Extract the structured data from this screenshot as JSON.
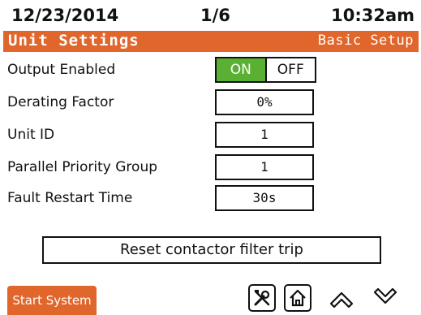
{
  "status_bar": {
    "date": "12/23/2014",
    "page": "1/6",
    "time": "10:32am"
  },
  "title_bar": {
    "title": "Unit Settings",
    "section": "Basic Setup",
    "color": "#e0662b"
  },
  "settings": [
    {
      "label": "Output Enabled",
      "type": "toggle",
      "on_label": "ON",
      "off_label": "OFF",
      "selected": "ON"
    },
    {
      "label": "Derating Factor",
      "type": "field",
      "value": "0%"
    },
    {
      "label": "Unit ID",
      "type": "field",
      "value": "1"
    },
    {
      "label": "Parallel Priority Group",
      "type": "field",
      "value": "1"
    },
    {
      "label": "Fault Restart Time",
      "type": "field",
      "value": "30s"
    }
  ],
  "reset_button": {
    "label": "Reset contactor filter trip"
  },
  "footer": {
    "start_button": "Start System",
    "icons": [
      "tools-icon",
      "home-icon",
      "chevron-up-icon",
      "chevron-down-icon"
    ]
  },
  "colors": {
    "accent": "#e0662b",
    "on_state": "#5ab033"
  }
}
